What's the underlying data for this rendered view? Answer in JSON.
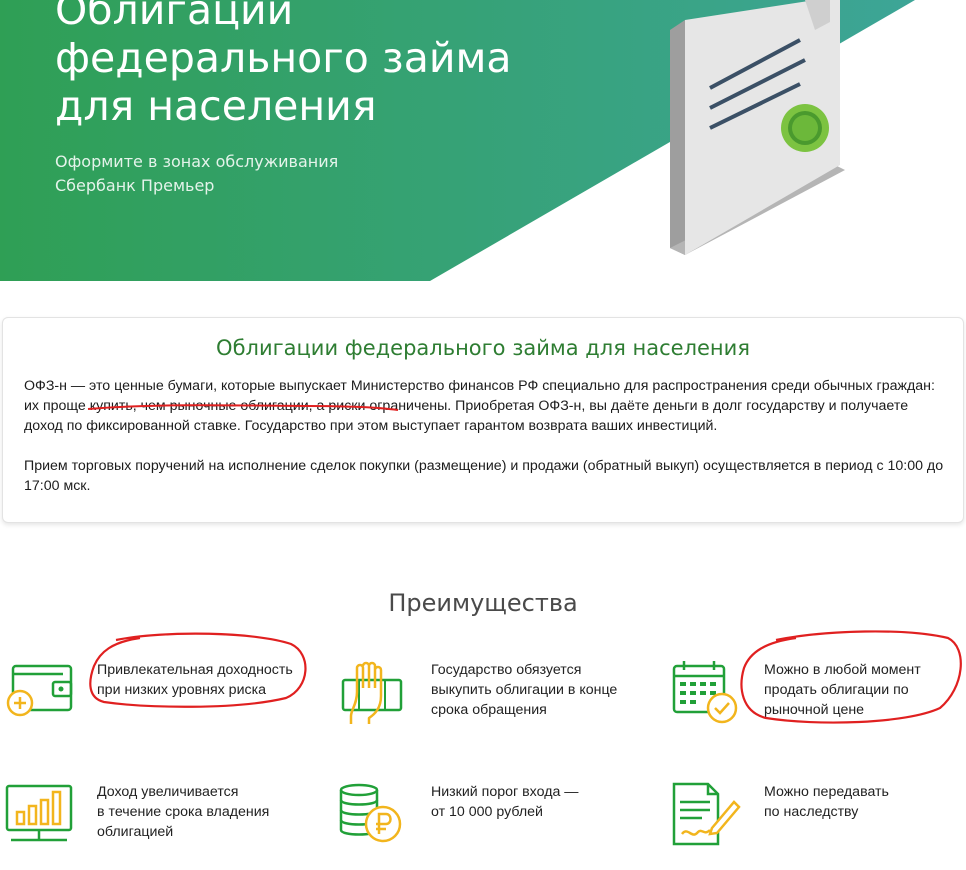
{
  "hero": {
    "title": "Облигации федерального займа для населения",
    "subtitle_line1": "Оформите в зонах обслуживания",
    "subtitle_line2": "Сбербанк Премьер",
    "colors": {
      "gradient_start": "#2f9f55",
      "gradient_end": "#3fa596"
    }
  },
  "info": {
    "title": "Облигации федерального займа для населения",
    "p1_start": "ОФЗ-н — это ценные бумаги, которые выпускает Министерство финансов РФ специально для распространения среди обычных граждан: ",
    "p1_highlight": "их проще купить, чем рыночные облигации",
    "p1_end": ", а риски ограничены. Приобретая ОФЗ-н, вы даёте деньги в долг государству и получаете доход по фиксированной ставке. Государство при этом выступает гарантом возврата ваших инвестиций.",
    "p2": "Прием торговых поручений на исполнение сделок покупки (размещение) и продажи (обратный выкуп) осуществляется в период с 10:00 до 17:00 мск."
  },
  "benefits": {
    "title": "Преимущества",
    "items": [
      {
        "icon": "wallet-plus-icon",
        "line1": "Привлекательная доходность",
        "line2": "при низких уровнях риска",
        "line3": ""
      },
      {
        "icon": "hand-money-icon",
        "line1": "Государство обязуется",
        "line2": "выкупить облигации в конце",
        "line3": "срока обращения"
      },
      {
        "icon": "calendar-check-icon",
        "line1": "Можно в любой момент",
        "line2": "продать облигации по",
        "line3": "рыночной цене"
      },
      {
        "icon": "growth-chart-icon",
        "line1": "Доход увеличивается",
        "line2": "в течение срока владения",
        "line3": "облигацией"
      },
      {
        "icon": "coins-ruble-icon",
        "line1": "Низкий порог входа —",
        "line2": "от 10 000 рублей",
        "line3": ""
      },
      {
        "icon": "document-sign-icon",
        "line1": "Можно передавать",
        "line2": "по наследству",
        "line3": ""
      }
    ]
  },
  "colors": {
    "green": "#21a038",
    "orange": "#f2b51d",
    "annotation_red": "#e02020"
  }
}
